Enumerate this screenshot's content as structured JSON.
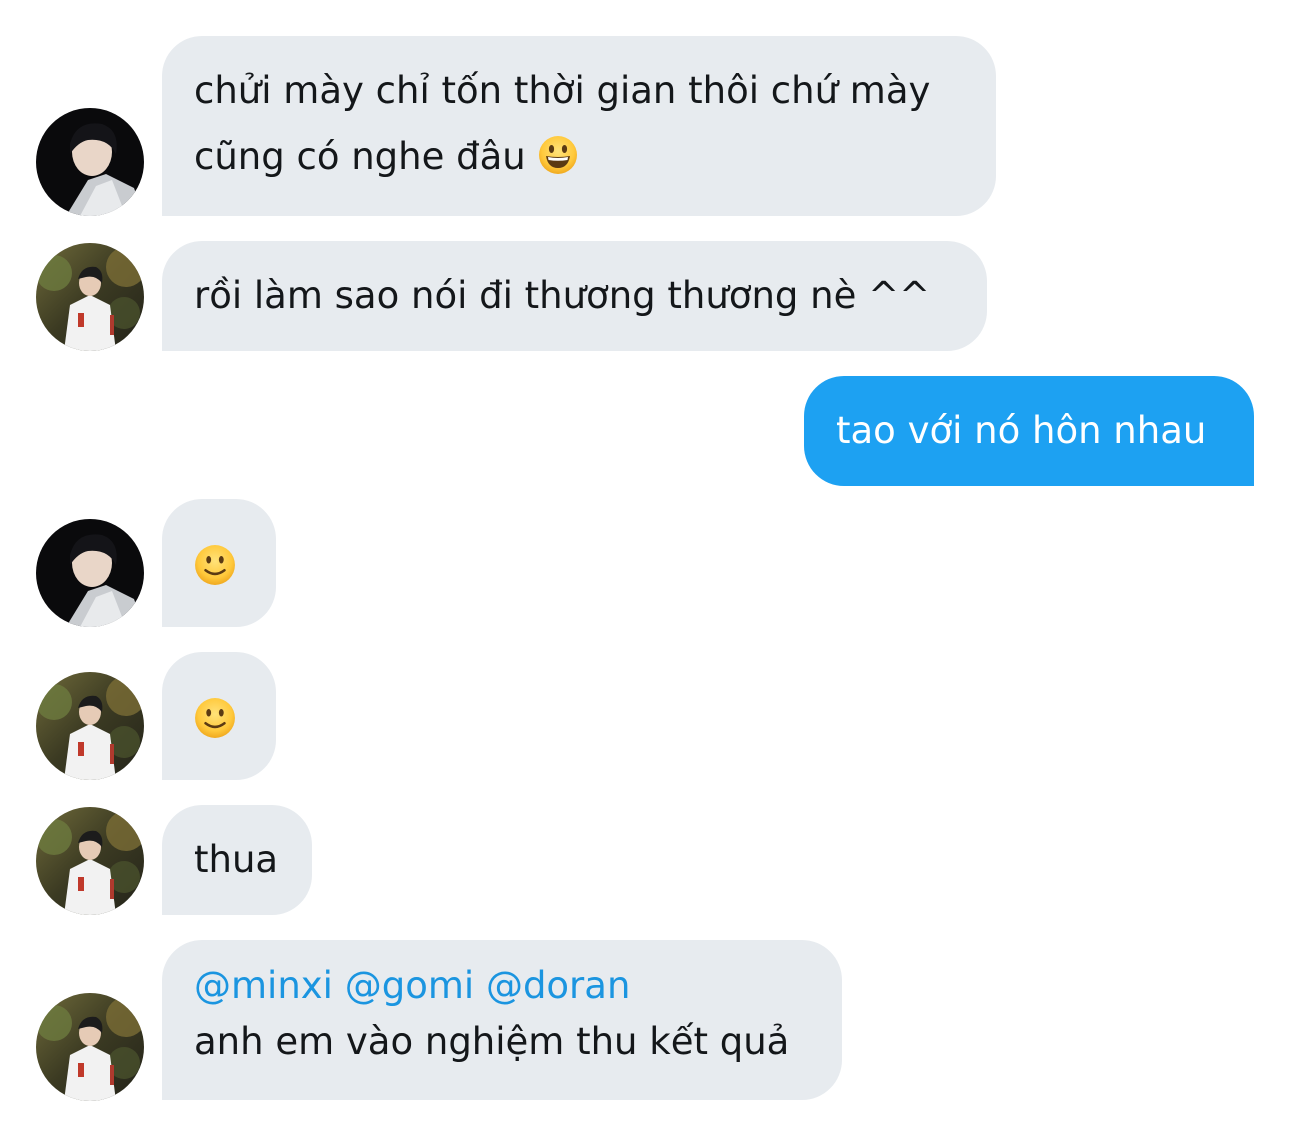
{
  "colors": {
    "received_bubble": "#e7ebef",
    "sent_bubble": "#1da1f2",
    "mention": "#1b95e0"
  },
  "messages": [
    {
      "side": "received",
      "avatar": "user-a-avatar",
      "lines": [
        "chửi mày chỉ tốn thời gian thôi chứ mày",
        "cũng có nghe đâu"
      ],
      "emoji": "grinning-face-emoji"
    },
    {
      "side": "received",
      "avatar": "user-b-avatar",
      "lines": [
        "rồi làm sao nói đi thương thương nè ^^"
      ]
    },
    {
      "side": "sent",
      "lines": [
        "tao với nó hôn nhau"
      ]
    },
    {
      "side": "received",
      "avatar": "user-a-avatar",
      "emoji": "slightly-smiling-face-emoji"
    },
    {
      "side": "received",
      "avatar": "user-b-avatar",
      "emoji": "slightly-smiling-face-emoji"
    },
    {
      "side": "received",
      "avatar": "user-b-avatar",
      "lines": [
        "thua"
      ]
    },
    {
      "side": "received",
      "avatar": "user-b-avatar",
      "mentions": [
        "@minxi",
        "@gomi",
        "@doran"
      ],
      "lines": [
        "anh em vào nghiệm thu kết quả"
      ]
    }
  ]
}
